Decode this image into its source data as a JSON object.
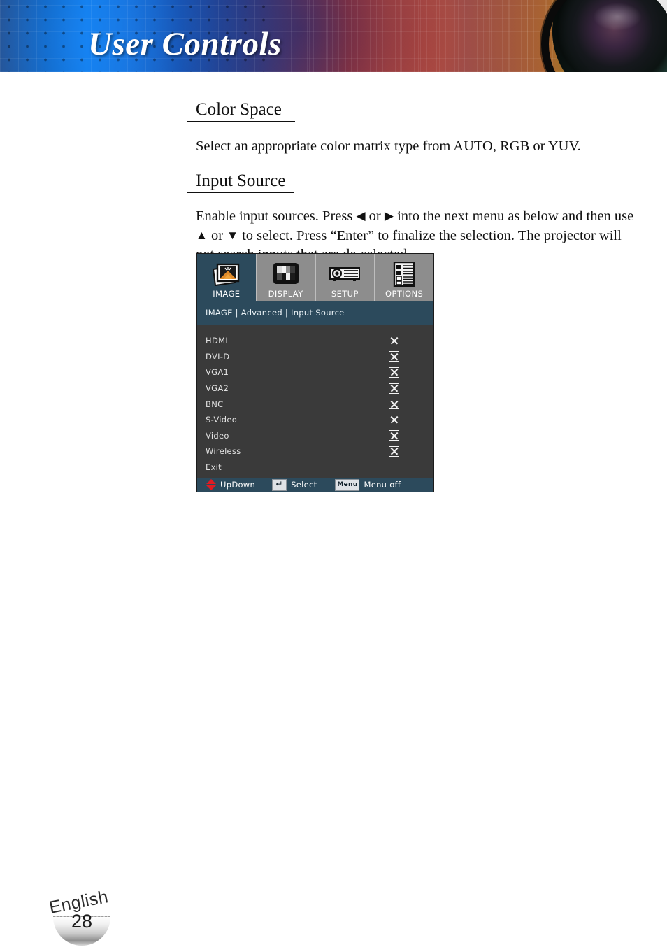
{
  "header": {
    "title": "User Controls",
    "lens_icon": "camera-lens-icon"
  },
  "sections": [
    {
      "heading": "Color Space",
      "body": "Select an appropriate color matrix type from AUTO, RGB or YUV."
    },
    {
      "heading": "Input Source",
      "body_line1_a": "Enable input sources. Press",
      "body_line1_arrow_left": "◀",
      "body_line1_b": "or",
      "body_line1_arrow_right": "▶",
      "body_line1_c": "into the next menu as below and",
      "body_line2_a": "then use",
      "body_line2_arrow_up": "▲",
      "body_line2_b": "or",
      "body_line2_arrow_down": "▼",
      "body_line2_c": "to select. Press “Enter” to finalize the selection.",
      "body_line3": "The projector will not search inputs that are de-selected."
    }
  ],
  "osd": {
    "tabs": [
      {
        "label": "IMAGE",
        "icon": "image-icon",
        "active": true
      },
      {
        "label": "DISPLAY",
        "icon": "display-icon",
        "active": false
      },
      {
        "label": "SETUP",
        "icon": "projector-icon",
        "active": false
      },
      {
        "label": "OPTIONS",
        "icon": "options-list-icon",
        "active": false
      }
    ],
    "breadcrumb": "IMAGE | Advanced | Input Source",
    "rows": [
      {
        "label": "HDMI",
        "checked": true
      },
      {
        "label": "DVI-D",
        "checked": true
      },
      {
        "label": "VGA1",
        "checked": true
      },
      {
        "label": "VGA2",
        "checked": true
      },
      {
        "label": "BNC",
        "checked": true
      },
      {
        "label": "S-Video",
        "checked": true
      },
      {
        "label": "Video",
        "checked": true
      },
      {
        "label": "Wireless",
        "checked": true
      },
      {
        "label": "Exit",
        "checked": false
      }
    ],
    "statusbar": {
      "updown_label": "UpDown",
      "updown_icon": "up-down-arrows-icon",
      "select_label": "Select",
      "select_icon": "enter-key-icon",
      "menuoff_label": "Menu off",
      "menuoff_icon": "menu-key-icon",
      "menuoff_icon_text": "Menu",
      "enter_glyph": "↵"
    },
    "colors": {
      "active_tab": "#2c4a5c",
      "inactive_tab": "#8d8d8d",
      "body": "#3a3a3a",
      "accent_red": "#e01b22"
    }
  },
  "footer": {
    "language": "English",
    "page_number": "28"
  }
}
